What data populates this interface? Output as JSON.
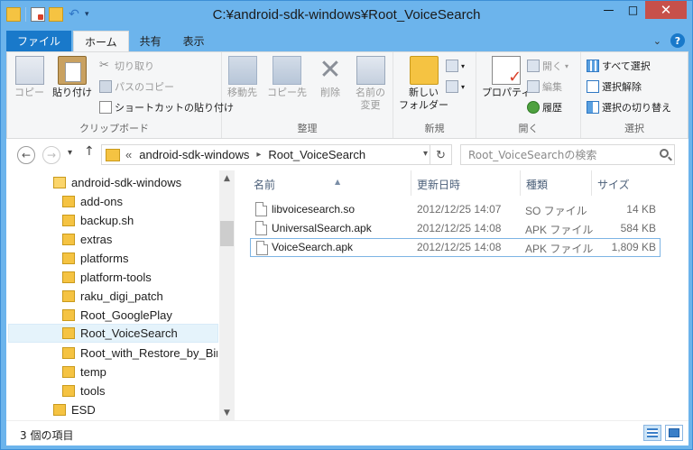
{
  "window": {
    "title": "C:¥android-sdk-windows¥Root_VoiceSearch",
    "minimize_glyph": "—",
    "maximize_glyph": "□",
    "close_glyph": "✕"
  },
  "ribbon_tabs": {
    "file": "ファイル",
    "home": "ホーム",
    "share": "共有",
    "view": "表示"
  },
  "ribbon": {
    "clipboard": {
      "label": "クリップボード",
      "copy": "コピー",
      "paste": "貼り付け",
      "cut": "切り取り",
      "copy_path": "パスのコピー",
      "paste_shortcut": "ショートカットの貼り付け"
    },
    "organize": {
      "label": "整理",
      "move_to": "移動先",
      "copy_to": "コピー先",
      "delete": "削除",
      "rename_line1": "名前の",
      "rename_line2": "変更"
    },
    "new": {
      "label": "新規",
      "new_folder_line1": "新しい",
      "new_folder_line2": "フォルダー"
    },
    "open": {
      "label": "開く",
      "properties": "プロパティ",
      "open": "開く",
      "edit": "編集",
      "history": "履歴"
    },
    "select": {
      "label": "選択",
      "select_all": "すべて選択",
      "select_none": "選択解除",
      "invert": "選択の切り替え"
    }
  },
  "address": {
    "prefix": "«",
    "crumbs": [
      "android-sdk-windows",
      "Root_VoiceSearch"
    ],
    "search_placeholder": "Root_VoiceSearchの検索"
  },
  "tree": {
    "items": [
      {
        "label": "android-sdk-windows",
        "level": 1
      },
      {
        "label": "add-ons",
        "level": 2
      },
      {
        "label": "backup.sh",
        "level": 2
      },
      {
        "label": "extras",
        "level": 2
      },
      {
        "label": "platforms",
        "level": 2
      },
      {
        "label": "platform-tools",
        "level": 2
      },
      {
        "label": "raku_digi_patch",
        "level": 2
      },
      {
        "label": "Root_GooglePlay",
        "level": 2
      },
      {
        "label": "Root_VoiceSearch",
        "level": 2,
        "selected": true
      },
      {
        "label": "Root_with_Restore_by_Bin",
        "level": 2
      },
      {
        "label": "temp",
        "level": 2
      },
      {
        "label": "tools",
        "level": 2
      },
      {
        "label": "ESD",
        "level": 1
      }
    ]
  },
  "files": {
    "columns": {
      "name": "名前",
      "modified": "更新日時",
      "type": "種類",
      "size": "サイズ"
    },
    "rows": [
      {
        "name": "libvoicesearch.so",
        "modified": "2012/12/25 14:07",
        "type": "SO ファイル",
        "size": "14 KB"
      },
      {
        "name": "UniversalSearch.apk",
        "modified": "2012/12/25 14:08",
        "type": "APK ファイル",
        "size": "584 KB"
      },
      {
        "name": "VoiceSearch.apk",
        "modified": "2012/12/25 14:08",
        "type": "APK ファイル",
        "size": "1,809 KB",
        "selected": true
      }
    ]
  },
  "status": {
    "item_count": "3 個の項目"
  },
  "colors": {
    "frame": "#6cb4ec",
    "file_tab": "#1979ca",
    "selection": "#e5f3fb",
    "close_button": "#c7504a"
  }
}
